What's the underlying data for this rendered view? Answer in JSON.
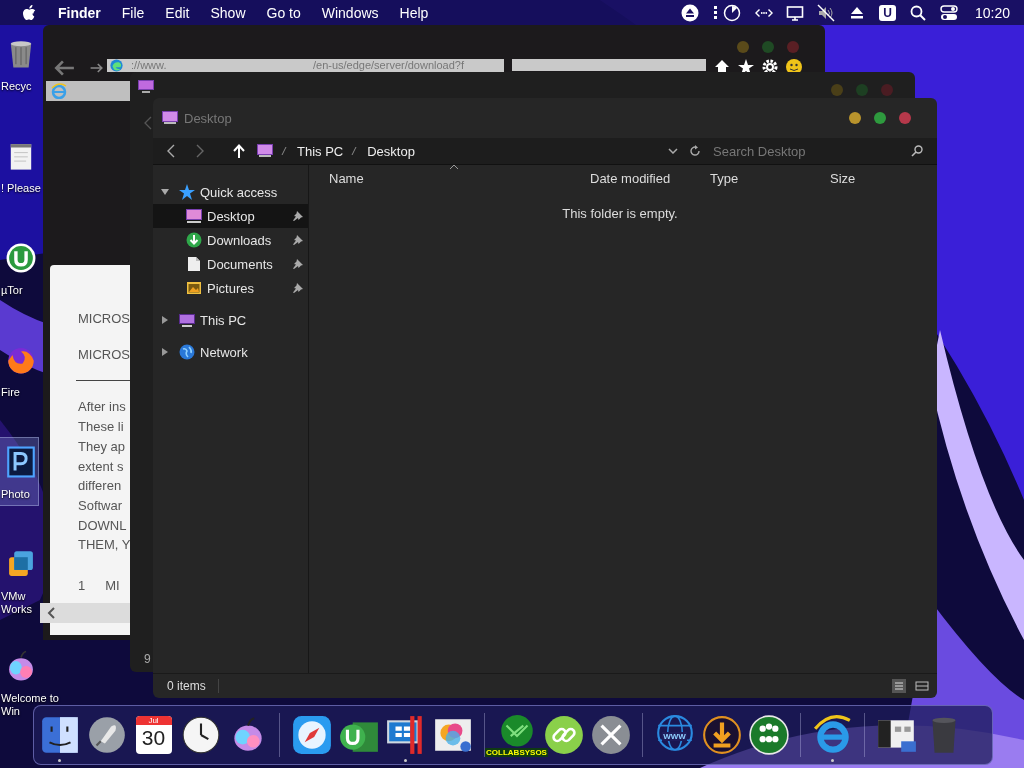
{
  "menu_bar": {
    "app": "Finder",
    "items": [
      "File",
      "Edit",
      "Show",
      "Go to",
      "Windows",
      "Help"
    ],
    "user_badge": "U",
    "clock": "10:20"
  },
  "desktop_icons": [
    {
      "kind": "trash",
      "label": "Recyc",
      "selected": false
    },
    {
      "kind": "notepad",
      "label": "! Please",
      "selected": false
    },
    {
      "kind": "utorrent",
      "label": "µTor",
      "selected": false
    },
    {
      "kind": "firefox",
      "label": "Fire",
      "selected": false
    },
    {
      "kind": "photoshop",
      "label": "Photo",
      "selected": true
    },
    {
      "kind": "vmware",
      "label": "VMw\nWorks",
      "selected": false
    },
    {
      "kind": "apple",
      "label": "Welcome to\nWin",
      "selected": false
    }
  ],
  "browser_window": {
    "url_start": "://www.",
    "url_path": "/en-us/edge/server/download?f"
  },
  "document_window": {
    "lines": [
      {
        "kind": "heading",
        "text": "MICROS"
      },
      {
        "kind": "heading",
        "text": "MICROS"
      },
      {
        "kind": "rule"
      },
      {
        "kind": "para",
        "text": "After ins"
      },
      {
        "kind": "para",
        "text": "These li"
      },
      {
        "kind": "line",
        "text": "They ap"
      },
      {
        "kind": "line",
        "text": "extent s"
      },
      {
        "kind": "line",
        "text": "differen"
      },
      {
        "kind": "line",
        "text": "Softwar"
      },
      {
        "kind": "line",
        "text": "DOWNL"
      },
      {
        "kind": "line",
        "text": "THEM, Y"
      },
      {
        "kind": "numbered",
        "number": "1",
        "text": "MI"
      }
    ]
  },
  "back_explorer": {
    "status_fragment": "9"
  },
  "explorer": {
    "title": "Desktop",
    "breadcrumb": [
      "This PC",
      "Desktop"
    ],
    "search": {
      "placeholder": "Search Desktop"
    },
    "columns": [
      "Name",
      "Date modified",
      "Type",
      "Size"
    ],
    "empty_message": "This folder is empty.",
    "sidebar": [
      {
        "kind": "star",
        "label": "Quick access",
        "expanded": true,
        "selected": false,
        "children": [
          {
            "kind": "desktop",
            "label": "Desktop",
            "pinned": true,
            "selected": true
          },
          {
            "kind": "downloads",
            "label": "Downloads",
            "pinned": true,
            "selected": false
          },
          {
            "kind": "documents",
            "label": "Documents",
            "pinned": true,
            "selected": false
          },
          {
            "kind": "pictures",
            "label": "Pictures",
            "pinned": true,
            "selected": false
          }
        ]
      },
      {
        "kind": "pc",
        "label": "This PC",
        "expanded": false,
        "selected": false
      },
      {
        "kind": "network",
        "label": "Network",
        "expanded": false,
        "selected": false
      }
    ],
    "status": "0 items"
  },
  "dock": [
    {
      "kind": "finder",
      "running": true
    },
    {
      "kind": "launchpad",
      "running": false
    },
    {
      "kind": "calendar",
      "month": "Jul",
      "day": "30",
      "running": false
    },
    {
      "kind": "clock",
      "running": false
    },
    {
      "kind": "siri",
      "running": false
    },
    {
      "kind": "separator"
    },
    {
      "kind": "safari",
      "running": false
    },
    {
      "kind": "utorrent",
      "running": false
    },
    {
      "kind": "parallels",
      "running": true
    },
    {
      "kind": "photos",
      "running": false
    },
    {
      "kind": "separator"
    },
    {
      "kind": "collab",
      "caption": "COLLABSYSOS",
      "running": false
    },
    {
      "kind": "link",
      "running": false
    },
    {
      "kind": "tools",
      "running": false
    },
    {
      "kind": "separator"
    },
    {
      "kind": "globe",
      "caption": "WWW",
      "running": false
    },
    {
      "kind": "download",
      "running": false
    },
    {
      "kind": "people",
      "running": false
    },
    {
      "kind": "separator"
    },
    {
      "kind": "ie",
      "running": true
    },
    {
      "kind": "separator"
    },
    {
      "kind": "screenshot",
      "running": false
    },
    {
      "kind": "trash",
      "running": false
    }
  ]
}
